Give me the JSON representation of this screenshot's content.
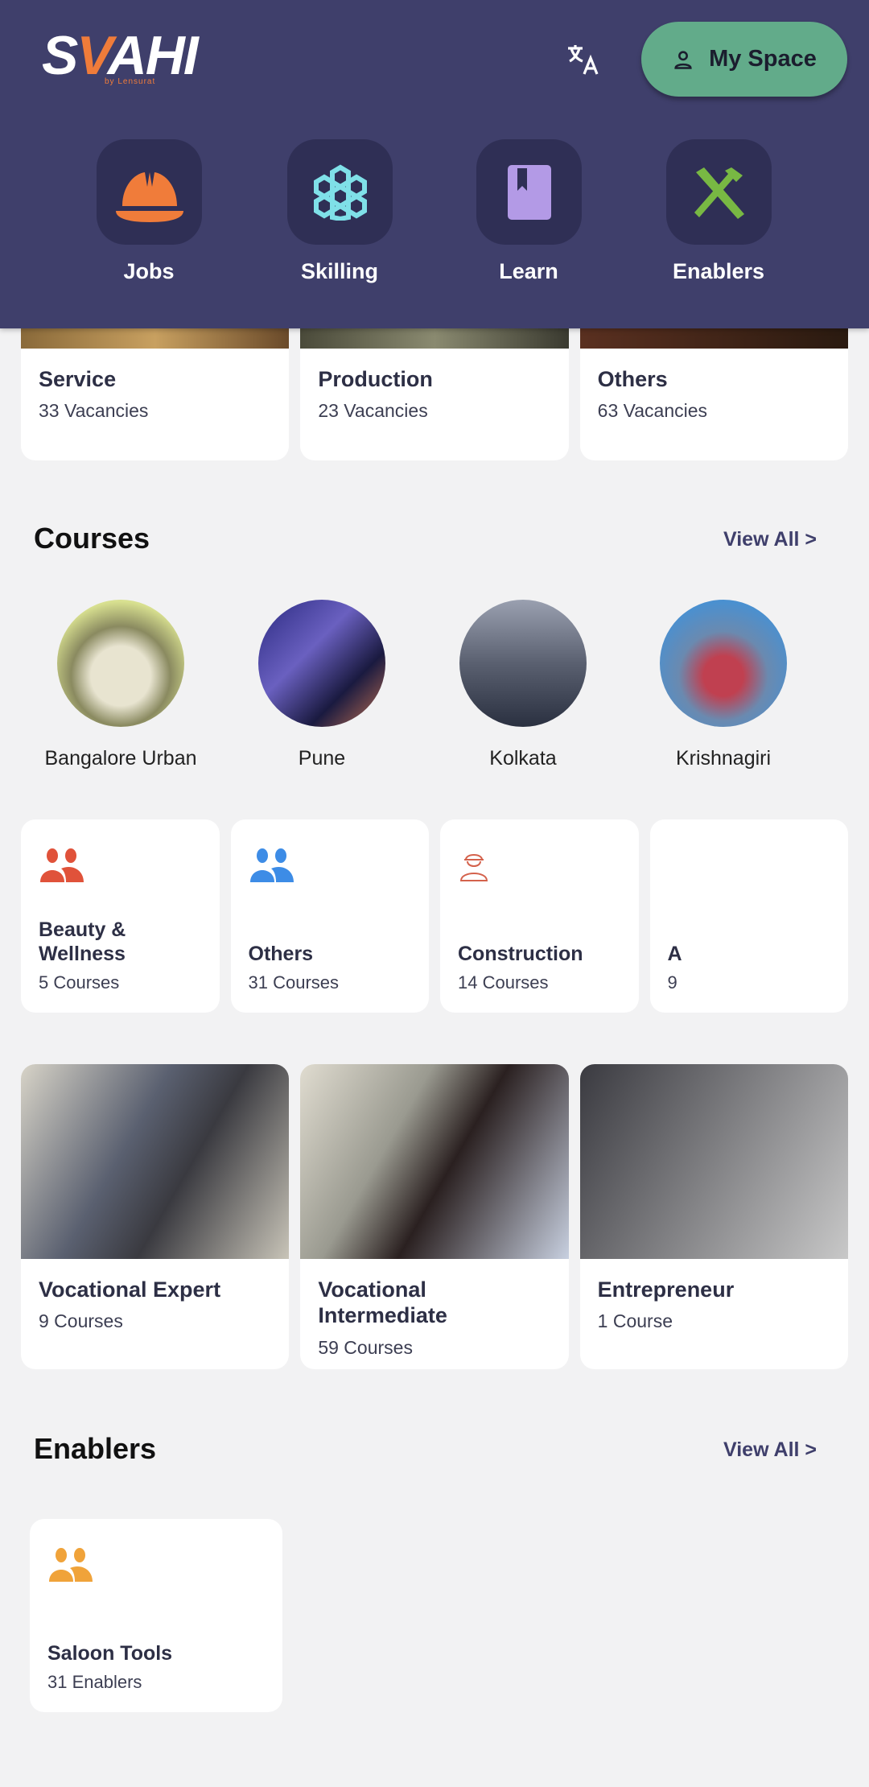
{
  "header": {
    "logo": "SAHI",
    "logo_sub": "by Lensurat",
    "translate_icon": "translate-icon",
    "my_space": "My Space"
  },
  "nav": [
    {
      "label": "Jobs",
      "icon": "hard-hat-icon",
      "color": "#f07c3a"
    },
    {
      "label": "Skilling",
      "icon": "honeycomb-icon",
      "color": "#7fe0e8"
    },
    {
      "label": "Learn",
      "icon": "book-icon",
      "color": "#b39ae6"
    },
    {
      "label": "Enablers",
      "icon": "tools-icon",
      "color": "#78b843"
    }
  ],
  "jobs": [
    {
      "title": "Service",
      "sub": "33 Vacancies"
    },
    {
      "title": "Production",
      "sub": "23 Vacancies"
    },
    {
      "title": "Others",
      "sub": "63 Vacancies"
    }
  ],
  "courses": {
    "heading": "Courses",
    "view_all": "View All >",
    "locations": [
      "Bangalore Urban",
      "Pune",
      "Kolkata",
      "Krishnagiri"
    ],
    "sectors": [
      {
        "title": "Beauty & Wellness",
        "sub": "5 Courses",
        "color": "#e0523a"
      },
      {
        "title": "Others",
        "sub": "31 Courses",
        "color": "#3d8ce6"
      },
      {
        "title": "Construction",
        "sub": "14 Courses",
        "color": "#d4624c"
      },
      {
        "title": "A",
        "sub": "9"
      }
    ],
    "levels": [
      {
        "title": "Vocational Expert",
        "sub": "9 Courses"
      },
      {
        "title": "Vocational Intermediate",
        "sub": "59 Courses"
      },
      {
        "title": "Entrepreneur",
        "sub": "1 Course"
      }
    ]
  },
  "enablers": {
    "heading": "Enablers",
    "view_all": "View All >",
    "items": [
      {
        "title": "Saloon Tools",
        "sub": "31 Enablers",
        "color": "#f0a33a"
      }
    ]
  }
}
